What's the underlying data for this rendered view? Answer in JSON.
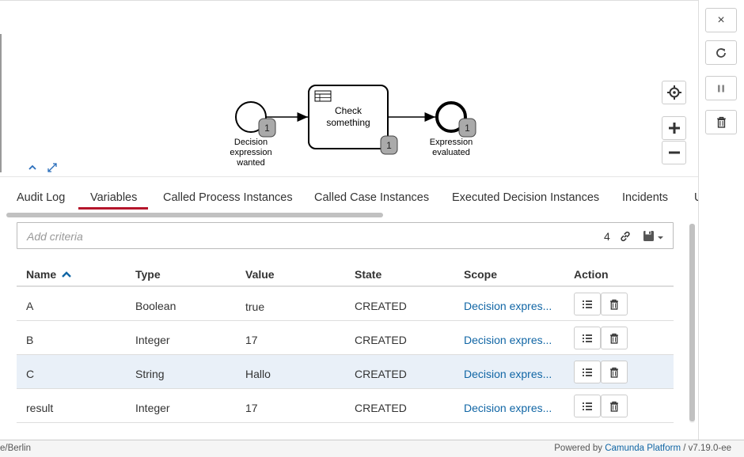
{
  "diagram": {
    "start_event": {
      "label_lines": [
        "Decision",
        "expression",
        "wanted"
      ],
      "badge": "1"
    },
    "task": {
      "label_lines": [
        "Check",
        "something"
      ],
      "badge": "1"
    },
    "end_event": {
      "label_lines": [
        "Expression",
        "evaluated"
      ],
      "badge": "1"
    }
  },
  "right_panel": {
    "buttons": [
      {
        "icon": "close-icon",
        "glyph": "×"
      },
      {
        "icon": "refresh-icon",
        "glyph": "↻"
      },
      {
        "icon": "pause-icon",
        "glyph": "⏸"
      },
      {
        "icon": "trash-icon",
        "glyph": "🗑"
      }
    ]
  },
  "tabs": [
    {
      "label": "Audit Log"
    },
    {
      "label": "Variables",
      "active": true
    },
    {
      "label": "Called Process Instances"
    },
    {
      "label": "Called Case Instances"
    },
    {
      "label": "Executed Decision Instances"
    },
    {
      "label": "Incidents"
    },
    {
      "label": "U"
    }
  ],
  "search": {
    "placeholder": "Add criteria",
    "count": "4"
  },
  "table": {
    "columns": [
      "Name",
      "Type",
      "Value",
      "State",
      "Scope",
      "Action"
    ],
    "sort": {
      "column": "Name",
      "direction": "ascending"
    },
    "rows": [
      {
        "name": "A",
        "type": "Boolean",
        "value": "true",
        "state": "CREATED",
        "scope": "Decision expres..."
      },
      {
        "name": "B",
        "type": "Integer",
        "value": "17",
        "state": "CREATED",
        "scope": "Decision expres..."
      },
      {
        "name": "C",
        "type": "String",
        "value": "Hallo",
        "state": "CREATED",
        "scope": "Decision expres...",
        "highlighted": true
      },
      {
        "name": "result",
        "type": "Integer",
        "value": "17",
        "state": "CREATED",
        "scope": "Decision expres..."
      }
    ]
  },
  "footer": {
    "timezone": "e/Berlin",
    "powered_by": "Powered by",
    "product": "Camunda Platform",
    "version": "/ v7.19.0-ee"
  },
  "colors": {
    "active_tab": "#b5152b",
    "link": "#1166a5",
    "row_highlight": "#e9f0f8"
  }
}
